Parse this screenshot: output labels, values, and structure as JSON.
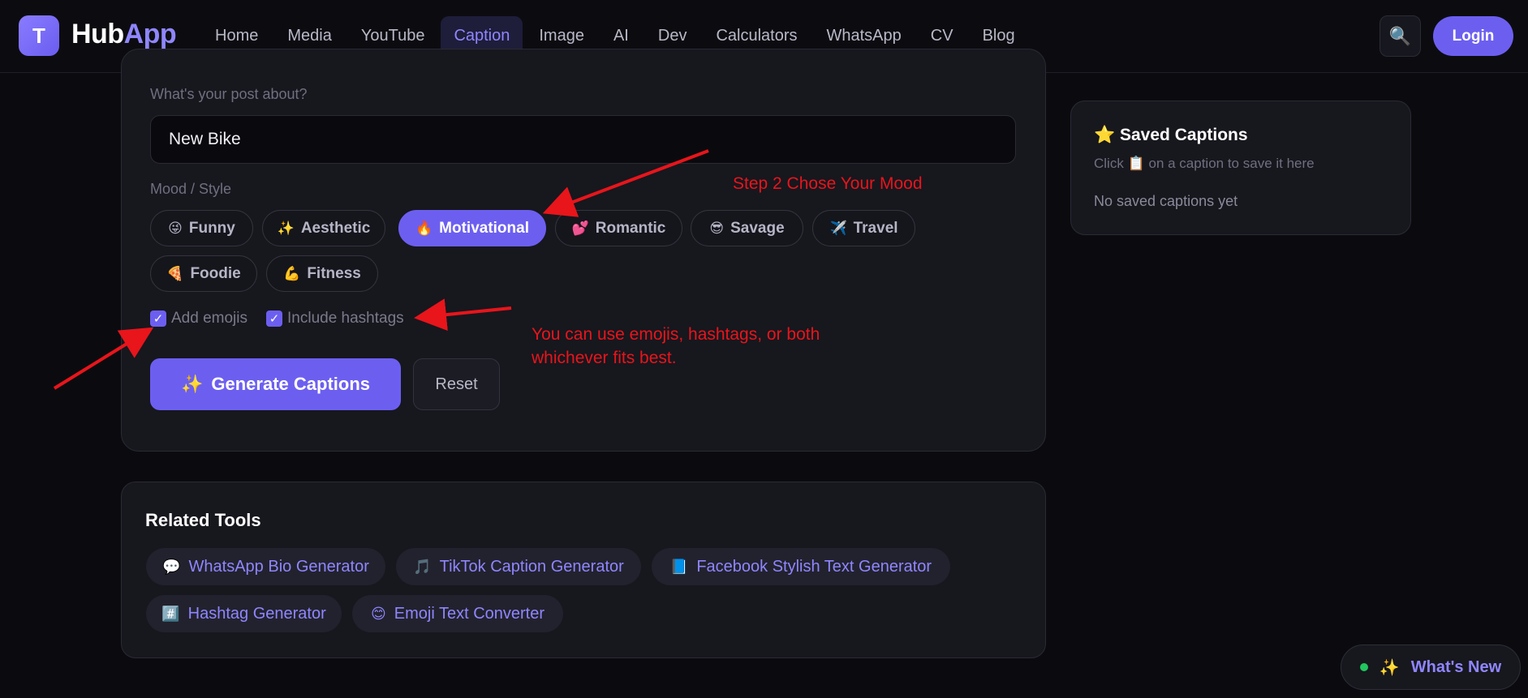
{
  "header": {
    "logo_letter": "T",
    "logo_hub": "Hub",
    "logo_app": "App",
    "nav": [
      "Home",
      "Media",
      "YouTube",
      "Caption",
      "Image",
      "AI",
      "Dev",
      "Calculators",
      "WhatsApp",
      "CV",
      "Blog"
    ],
    "active_nav": "Caption",
    "search_icon": "🔍",
    "login_label": "Login"
  },
  "form": {
    "post_label": "What's your post about?",
    "post_value": "New Bike",
    "mood_label": "Mood / Style",
    "moods": [
      {
        "emoji": "😜",
        "label": "Funny"
      },
      {
        "emoji": "✨",
        "label": "Aesthetic"
      },
      {
        "emoji": "🔥",
        "label": "Motivational"
      },
      {
        "emoji": "💕",
        "label": "Romantic"
      },
      {
        "emoji": "😎",
        "label": "Savage"
      },
      {
        "emoji": "✈️",
        "label": "Travel"
      },
      {
        "emoji": "🍕",
        "label": "Foodie"
      },
      {
        "emoji": "💪",
        "label": "Fitness"
      }
    ],
    "active_mood": "Motivational",
    "add_emojis_label": "Add emojis",
    "include_hashtags_label": "Include hashtags",
    "check_mark": "✓",
    "generate_emoji": "✨",
    "generate_label": "Generate Captions",
    "reset_label": "Reset"
  },
  "saved": {
    "star": "⭐",
    "title": "Saved Captions",
    "hint_before": "Click",
    "hint_icon": "📋",
    "hint_after": "on a caption to save it here",
    "empty": "No saved captions yet"
  },
  "related": {
    "title": "Related Tools",
    "tools": [
      {
        "emoji": "💬",
        "label": "WhatsApp Bio Generator"
      },
      {
        "emoji": "🎵",
        "label": "TikTok Caption Generator"
      },
      {
        "emoji": "📘",
        "label": "Facebook Stylish Text Generator"
      },
      {
        "emoji": "#️⃣",
        "label": "Hashtag Generator"
      },
      {
        "emoji": "😊",
        "label": "Emoji Text Converter"
      }
    ]
  },
  "whats_new": {
    "emoji": "✨",
    "label": "What's New"
  },
  "annotations": {
    "step2": "Step 2 Chose Your Mood",
    "emoji_line1": "You can use emojis, hashtags, or both",
    "emoji_line2": "whichever fits best.",
    "color": "#e8151b"
  },
  "colors": {
    "accent": "#6c5ff0",
    "accent_text": "#8f86ff",
    "background": "#0b0b0f",
    "card": "#17171e"
  }
}
